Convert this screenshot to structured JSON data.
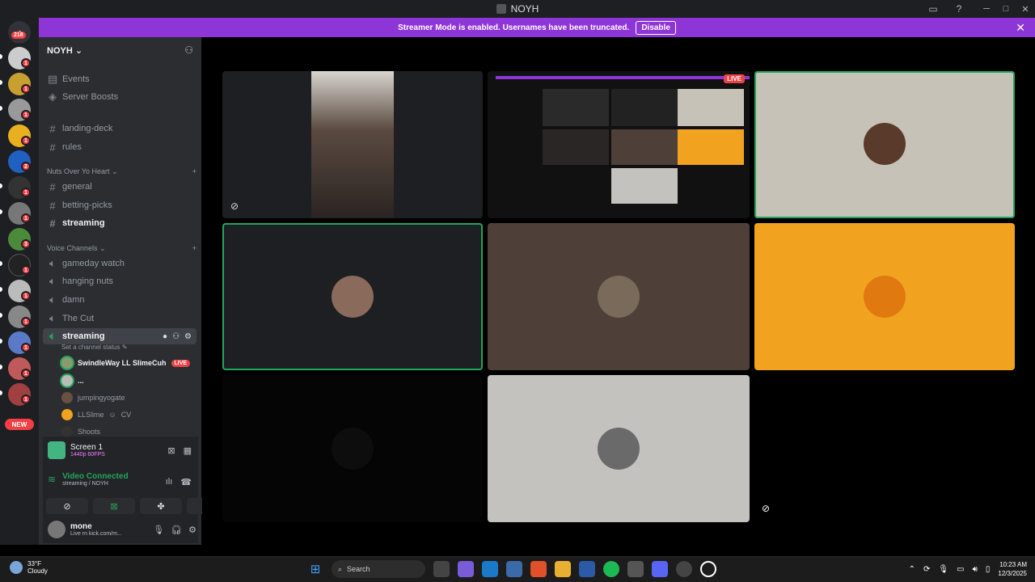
{
  "window": {
    "title": "NOYH"
  },
  "banner": {
    "text": "Streamer Mode is enabled. Usernames have been truncated.",
    "disable_label": "Disable",
    "color": "#8e35d8"
  },
  "rail": {
    "home_badge": "218",
    "badges": [
      "1",
      "1",
      "1",
      "1",
      "2",
      "1",
      "1",
      "3",
      "1",
      "1",
      "1",
      "1",
      "1",
      "1"
    ],
    "new_label": "NEW"
  },
  "server": {
    "name": "NOYH",
    "nav": [
      {
        "icon": "calendar-icon",
        "label": "Events"
      },
      {
        "icon": "boost-icon",
        "label": "Server Boosts"
      }
    ],
    "top_channels": [
      "landing-deck",
      "rules"
    ],
    "category_text": "Nuts Over Yo Heart",
    "text_channels": [
      "general",
      "betting-picks",
      "streaming"
    ],
    "category_voice": "Voice Channels",
    "voice_channels": [
      "gameday watch",
      "hanging nuts",
      "damn",
      "The Cut"
    ],
    "active_voice": {
      "name": "streaming",
      "status_placeholder": "Set a channel status",
      "users": [
        {
          "name": "SwindleWay LL SlimeCuh",
          "live": "LIVE"
        },
        {
          "name": "..."
        },
        {
          "name": "jumpingyogate"
        },
        {
          "name": "LLSlime",
          "extra": "CV"
        },
        {
          "name": "Shoots"
        }
      ]
    }
  },
  "rtc": {
    "screen_title": "Screen 1",
    "screen_quality": "1440p 60FPS",
    "connection_title": "Video Connected",
    "connection_sub": "streaming / NOYH"
  },
  "user": {
    "name": "mone",
    "status": "Live rn kick.com/m..."
  },
  "stage": {
    "live_label": "LIVE",
    "tile_colors": {
      "dark": "#1e1f22",
      "brown": "#4e4038",
      "beige": "#c6c2b7",
      "orange": "#f1a31f",
      "grey": "#c4c2bf"
    }
  },
  "taskbar": {
    "temp": "33°F",
    "weather": "Cloudy",
    "search_placeholder": "Search",
    "time": "10:23 AM",
    "date": "12/3/2025"
  }
}
